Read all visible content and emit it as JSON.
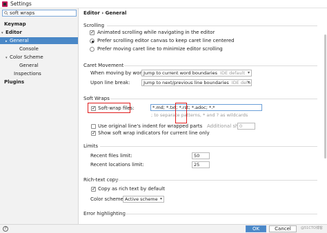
{
  "window": {
    "title": "Settings"
  },
  "search": {
    "value": "soft wraps"
  },
  "sidebar": {
    "items": [
      {
        "label": "Keymap",
        "arrow": ""
      },
      {
        "label": "Editor",
        "arrow": "▾"
      },
      {
        "label": "General",
        "arrow": "▸"
      },
      {
        "label": "Console",
        "arrow": ""
      },
      {
        "label": "Color Scheme",
        "arrow": "▾"
      },
      {
        "label": "General",
        "arrow": ""
      },
      {
        "label": "Inspections",
        "arrow": ""
      },
      {
        "label": "Plugins",
        "arrow": ""
      }
    ]
  },
  "breadcrumb": {
    "parent": "Editor",
    "sep": "›",
    "current": "General"
  },
  "scrolling": {
    "title": "Scrolling",
    "animated": "Animated scrolling while navigating in the editor",
    "prefer_canvas": "Prefer scrolling editor canvas to keep caret line centered",
    "prefer_caret": "Prefer moving caret line to minimize editor scrolling"
  },
  "caret": {
    "title": "Caret Movement",
    "words_label": "When moving by words:",
    "words_value": "Jump to current word boundaries",
    "words_hint": "IDE default",
    "line_label": "Upon line break:",
    "line_value": "Jump to next/previous line boundaries",
    "line_hint": "IDE default"
  },
  "soft_wraps": {
    "title": "Soft Wraps",
    "files_label": "Soft-wrap files:",
    "files_value": "*.md; *.txt; *.rst; *.adoc; *.*",
    "files_hint": "; to separate patterns, * and ? as wildcards",
    "original_indent": "Use original line's indent for wrapped parts",
    "additional_shift_label": "Additional shift:",
    "additional_shift_value": "0",
    "show_indicators": "Show soft wrap indicators for current line only"
  },
  "limits": {
    "title": "Limits",
    "recent_files_label": "Recent files limit:",
    "recent_files_value": "50",
    "recent_locations_label": "Recent locations limit:",
    "recent_locations_value": "25"
  },
  "rich_text": {
    "title": "Rich-text copy",
    "copy_label": "Copy as rich text by default",
    "scheme_label": "Color scheme:",
    "scheme_value": "Active scheme"
  },
  "error_highlighting": {
    "title": "Error highlighting"
  },
  "footer": {
    "help": "?",
    "ok": "OK",
    "cancel": "Cancel",
    "watermark": "@51CTO博客"
  },
  "colors": {
    "accent": "#4a88c7",
    "highlight": "#e01b1b"
  }
}
